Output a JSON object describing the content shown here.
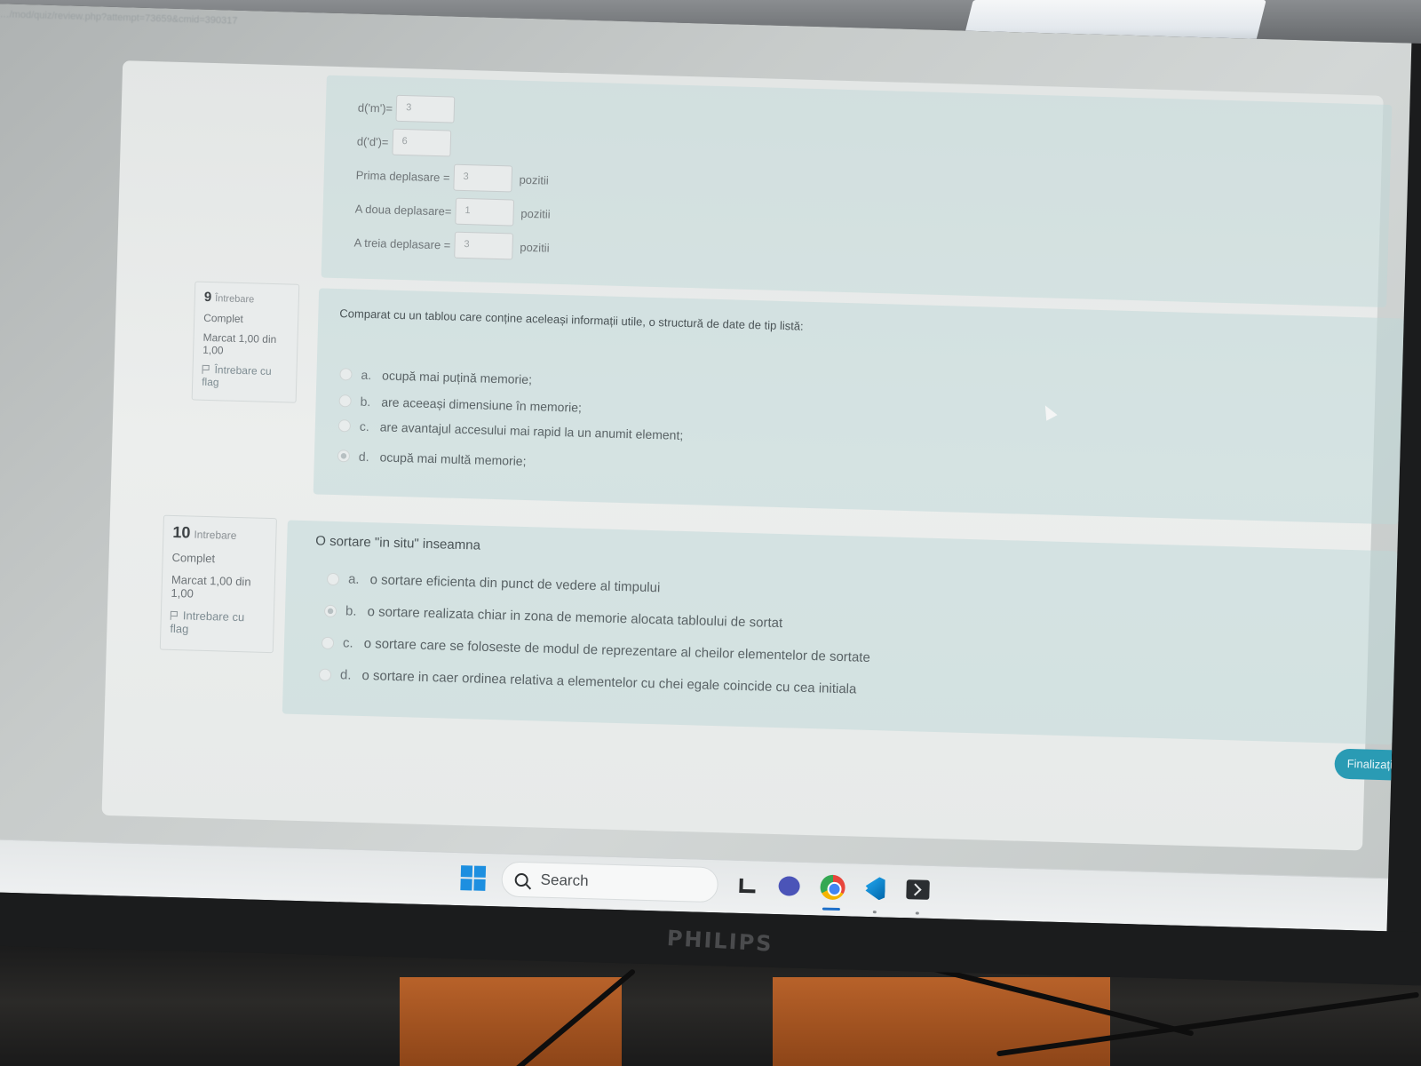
{
  "browser": {
    "url": "…/mod/quiz/review.php?attempt=73659&cmid=390317"
  },
  "previous_question": {
    "fields": [
      {
        "label": "d('m')=",
        "value": "3",
        "unit": ""
      },
      {
        "label": "d('d')=",
        "value": "6",
        "unit": ""
      },
      {
        "label": "Prima deplasare =",
        "value": "3",
        "unit": "pozitii"
      },
      {
        "label": "A doua deplasare=",
        "value": "1",
        "unit": "pozitii"
      },
      {
        "label": "A treia deplasare =",
        "value": "3",
        "unit": "pozitii"
      }
    ]
  },
  "questions": [
    {
      "number": "9",
      "word": "Întrebare",
      "status": "Complet",
      "mark": "Marcat 1,00 din 1,00",
      "flag_label": "Întrebare cu flag",
      "text": "Comparat cu un tablou care conține aceleași informații utile, o structură de date de tip listă:",
      "answers": [
        {
          "letter": "a.",
          "text": "ocupă mai puțină memorie;",
          "selected": false
        },
        {
          "letter": "b.",
          "text": "are aceeași dimensiune în memorie;",
          "selected": false
        },
        {
          "letter": "c.",
          "text": "are avantajul accesului mai rapid la un anumit element;",
          "selected": false
        },
        {
          "letter": "d.",
          "text": "ocupă mai multă memorie;",
          "selected": true
        }
      ]
    },
    {
      "number": "10",
      "word": "Intrebare",
      "status": "Complet",
      "mark": "Marcat 1,00 din 1,00",
      "flag_label": "Intrebare cu flag",
      "text": "O sortare \"in situ\" inseamna",
      "answers": [
        {
          "letter": "a.",
          "text": "o sortare eficienta din punct de vedere al timpului",
          "selected": false
        },
        {
          "letter": "b.",
          "text": "o sortare realizata chiar in zona de memorie alocata tabloului de sortat",
          "selected": true
        },
        {
          "letter": "c.",
          "text": "o sortare care se foloseste de modul de reprezentare al cheilor elementelor de sortate",
          "selected": false
        },
        {
          "letter": "d.",
          "text": "o sortare in caer ordinea relativa a elementelor cu chei egale coincide cu cea initiala",
          "selected": false
        }
      ]
    }
  ],
  "finish_button": "Finalizați",
  "taskbar": {
    "search_label": "Search",
    "icons": [
      "windows-start-icon",
      "file-explorer-icon",
      "video-call-icon",
      "chrome-icon",
      "vscode-icon",
      "terminal-icon"
    ],
    "accent_color": "#1d8fe0"
  },
  "monitor_brand": "PHILIPS"
}
